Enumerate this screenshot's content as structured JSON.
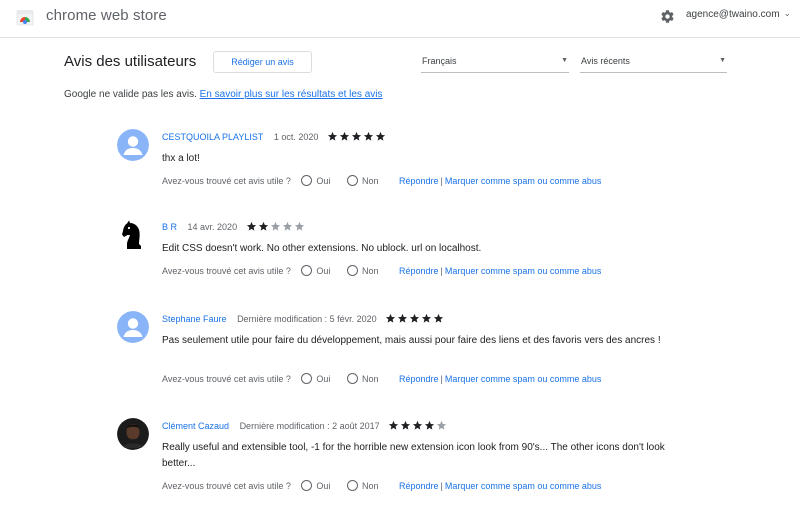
{
  "header": {
    "store_name": "chrome web store",
    "account": "agence@twaino.com"
  },
  "section": {
    "title": "Avis des utilisateurs",
    "write_review": "Rédiger un avis",
    "language_filter": "Français",
    "sort_filter": "Avis récents",
    "notice_text": "Google ne valide pas les avis.",
    "notice_link": "En savoir plus sur les résultats et les avis"
  },
  "feedback": {
    "question": "Avez-vous trouvé cet avis utile ?",
    "yes": "Oui",
    "no": "Non",
    "reply": "Répondre",
    "separator": "|",
    "spam": "Marquer comme spam ou comme abus"
  },
  "reviews": [
    {
      "author": "CESTQUOILA PLAYLIST",
      "date": "1 oct. 2020",
      "rating": 5,
      "text": "thx a lot!",
      "avatar": "default-person-icon"
    },
    {
      "author": "B R",
      "date": "14 avr. 2020",
      "rating": 2,
      "text": "Edit CSS doesn't work. No other extensions. No ublock. url on localhost.",
      "avatar": "chess-knight-icon"
    },
    {
      "author": "Stephane Faure",
      "date": "Dernière modification : 5 févr. 2020",
      "rating": 5,
      "text": "Pas seulement utile pour faire du développement, mais aussi pour faire des liens et des favoris vers des ancres !",
      "avatar": "default-person-icon"
    },
    {
      "author": "Clément Cazaud",
      "date": "Dernière modification : 2 août 2017",
      "rating": 4,
      "text": "Really useful and extensible tool, -1 for the horrible new extension icon look from 90's... The other icons don't look better...",
      "avatar": "user-photo"
    }
  ],
  "colors": {
    "accent": "#1a73e8",
    "star_filled": "#202124",
    "star_empty": "#9aa0a6",
    "avatar_default": "#8ab4f8"
  }
}
